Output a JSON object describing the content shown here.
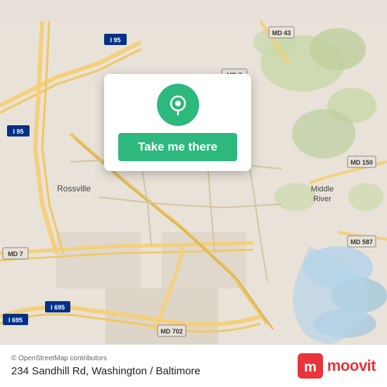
{
  "map": {
    "background_color": "#e8e0d8",
    "alt": "Map of Baltimore/Washington area showing Rossville and Middle River neighborhoods"
  },
  "action_card": {
    "button_label": "Take me there",
    "pin_color": "#2db87d"
  },
  "bottom_bar": {
    "copyright": "© OpenStreetMap contributors",
    "address": "234 Sandhill Rd, Washington / Baltimore",
    "logo_name": "moovit"
  }
}
